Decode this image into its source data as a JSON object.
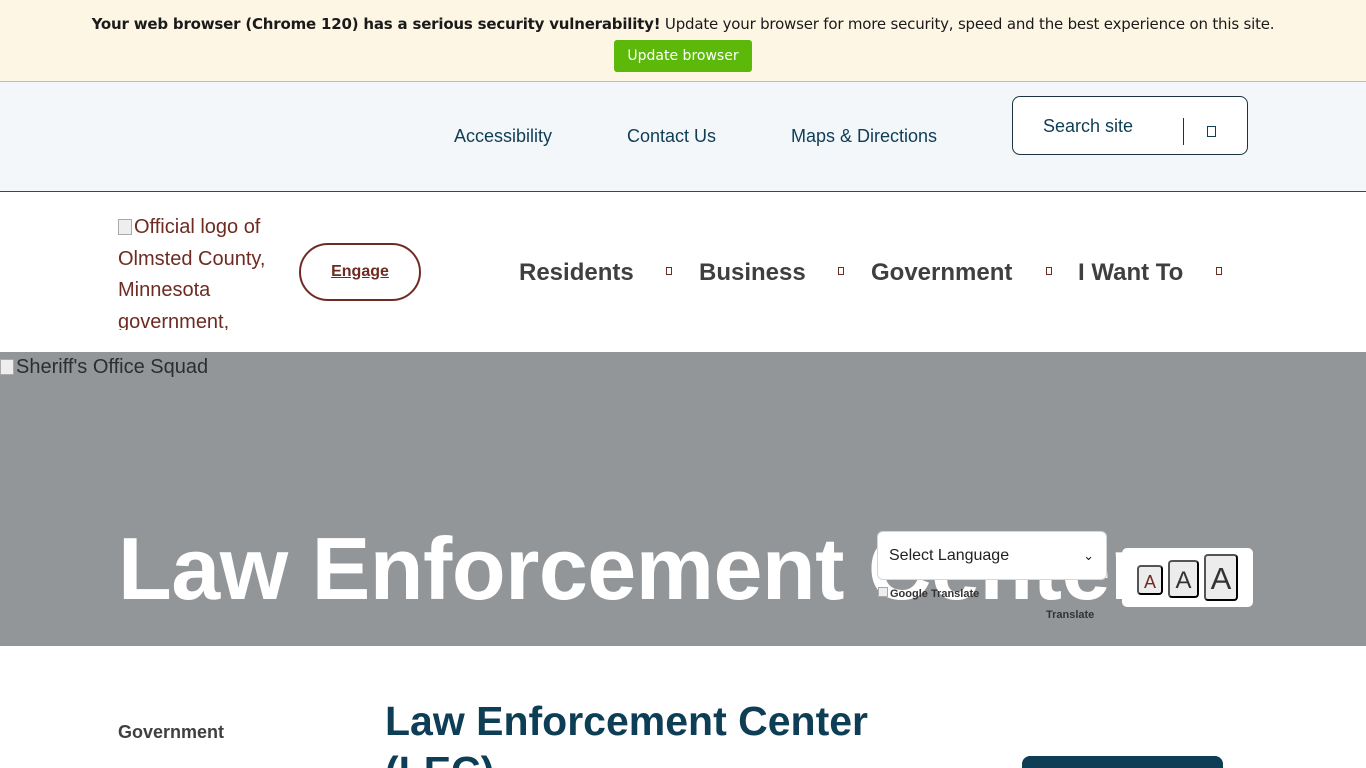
{
  "banner": {
    "bold_text": "Your web browser (Chrome 120) has a serious security vulnerability!",
    "text": " Update your browser for more security, speed and the best experience on this site.",
    "button_label": "Update browser"
  },
  "utility_nav": {
    "links": [
      "Accessibility",
      "Contact Us",
      "Maps & Directions"
    ],
    "search_label": "Search site",
    "search_icon": "search-icon"
  },
  "main_nav": {
    "logo_alt": "Official logo of Olmsted County, Minnesota government,",
    "engage_label": "Engage",
    "items": [
      "Residents",
      "Business",
      "Government",
      "I Want To"
    ]
  },
  "hero": {
    "image_alt": "Sheriff's Office Squad",
    "title": "Law Enforcement Center"
  },
  "translate": {
    "select_label": "Select Language",
    "logo_alt": "Google Translate",
    "label": "Translate"
  },
  "font_size": {
    "small": "A",
    "medium": "A",
    "large": "A"
  },
  "content": {
    "sidebar_heading": "Government",
    "page_title": "Law Enforcement Center (LEC)"
  },
  "colors": {
    "banner_bg": "#fdf6e4",
    "update_button": "#5cb90a",
    "brand_maroon": "#6e2b22",
    "brand_navy": "#0e3d56",
    "hero_bg": "#939699"
  }
}
